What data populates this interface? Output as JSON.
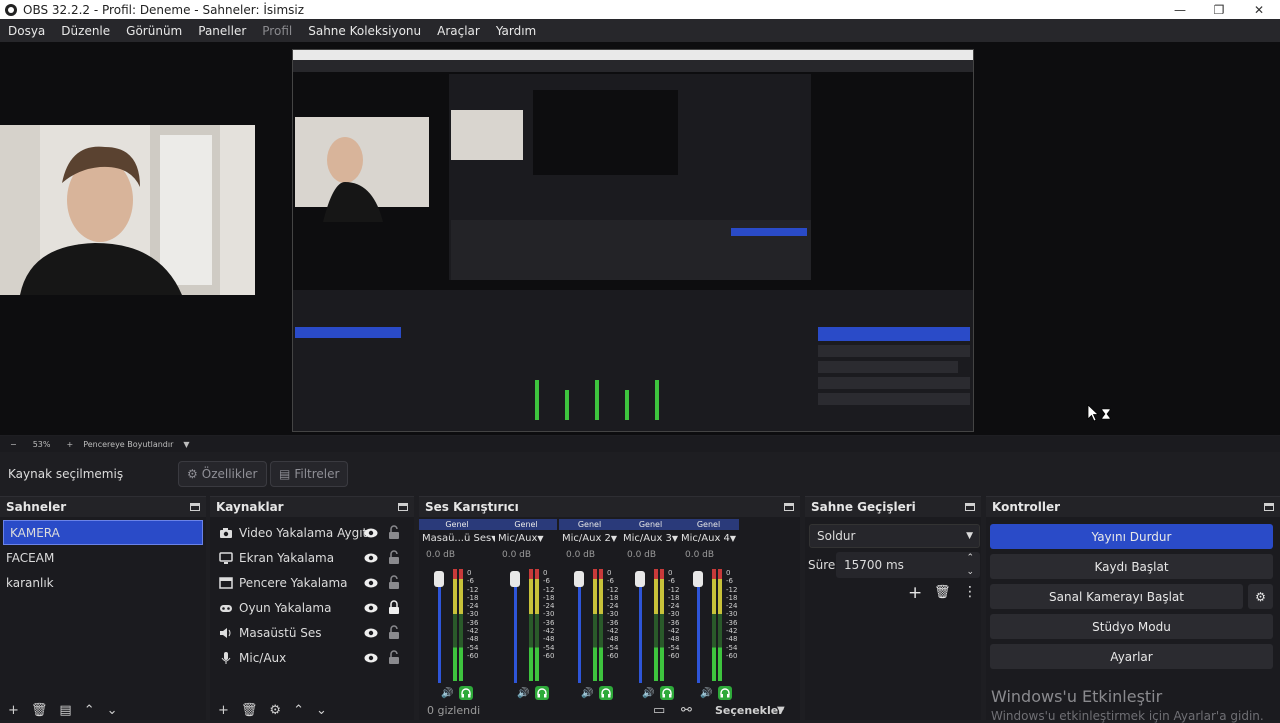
{
  "window": {
    "title": "OBS 32.2.2 - Profil: Deneme - Sahneler: İsimsiz",
    "minimize": "—",
    "maximize": "❐",
    "close": "✕"
  },
  "menu": [
    "Dosya",
    "Düzenle",
    "Görünüm",
    "Paneller",
    "Profil",
    "Sahne Koleksiyonu",
    "Araçlar",
    "Yardım"
  ],
  "zoom": {
    "minus": "−",
    "percent": "53%",
    "plus": "+",
    "label": "Pencereye Boyutlandır"
  },
  "source_bar": {
    "status": "Kaynak seçilmemiş",
    "properties": "Özellikler",
    "filters": "Filtreler"
  },
  "scenes": {
    "title": "Sahneler",
    "items": [
      "KAMERA",
      "FACEAM",
      "karanlık"
    ],
    "selected": "KAMERA"
  },
  "sources": {
    "title": "Kaynaklar",
    "items": [
      {
        "label": "Video Yakalama Aygıtı",
        "icon": "camera-icon",
        "locked": false
      },
      {
        "label": "Ekran Yakalama",
        "icon": "monitor-icon",
        "locked": false
      },
      {
        "label": "Pencere Yakalama",
        "icon": "window-icon",
        "locked": false
      },
      {
        "label": "Oyun Yakalama",
        "icon": "gamepad-icon",
        "locked": true
      },
      {
        "label": "Masaüstü Ses",
        "icon": "speaker-icon",
        "locked": false
      },
      {
        "label": "Mic/Aux",
        "icon": "microphone-icon",
        "locked": false
      }
    ]
  },
  "mixer": {
    "title": "Ses Karıştırıcı",
    "group": "Genel",
    "channels": [
      {
        "name": "Masaü...ü Ses",
        "db": "0.0 dB"
      },
      {
        "name": "Mic/Aux",
        "db": "0.0 dB"
      },
      {
        "name": "Mic/Aux 2",
        "db": "0.0 dB"
      },
      {
        "name": "Mic/Aux 3",
        "db": "0.0 dB"
      },
      {
        "name": "Mic/Aux 4",
        "db": "0.0 dB"
      }
    ],
    "scale": [
      "0",
      "-6",
      "-12",
      "-18",
      "-24",
      "-30",
      "-36",
      "-42",
      "-48",
      "-54",
      "-60"
    ],
    "hidden": "0 gizlendi",
    "options": "Seçenekler"
  },
  "transitions": {
    "title": "Sahne Geçişleri",
    "type": "Soldur",
    "duration_label": "Süre",
    "duration": "15700 ms"
  },
  "controls": {
    "title": "Kontroller",
    "buttons": [
      "Yayını Durdur",
      "Kaydı Başlat",
      "Sanal Kamerayı Başlat",
      "Stüdyo Modu",
      "Ayarlar"
    ],
    "watermark": "Windows'u Etkinleştir",
    "watermark_sub": "Windows'u etkinleştirmek için Ayarlar'a gidin."
  },
  "colors": {
    "accent": "#2a4bc8",
    "meter_green": "#3ec43e",
    "meter_yellow": "#c8c23a",
    "meter_red": "#c83a3a"
  }
}
